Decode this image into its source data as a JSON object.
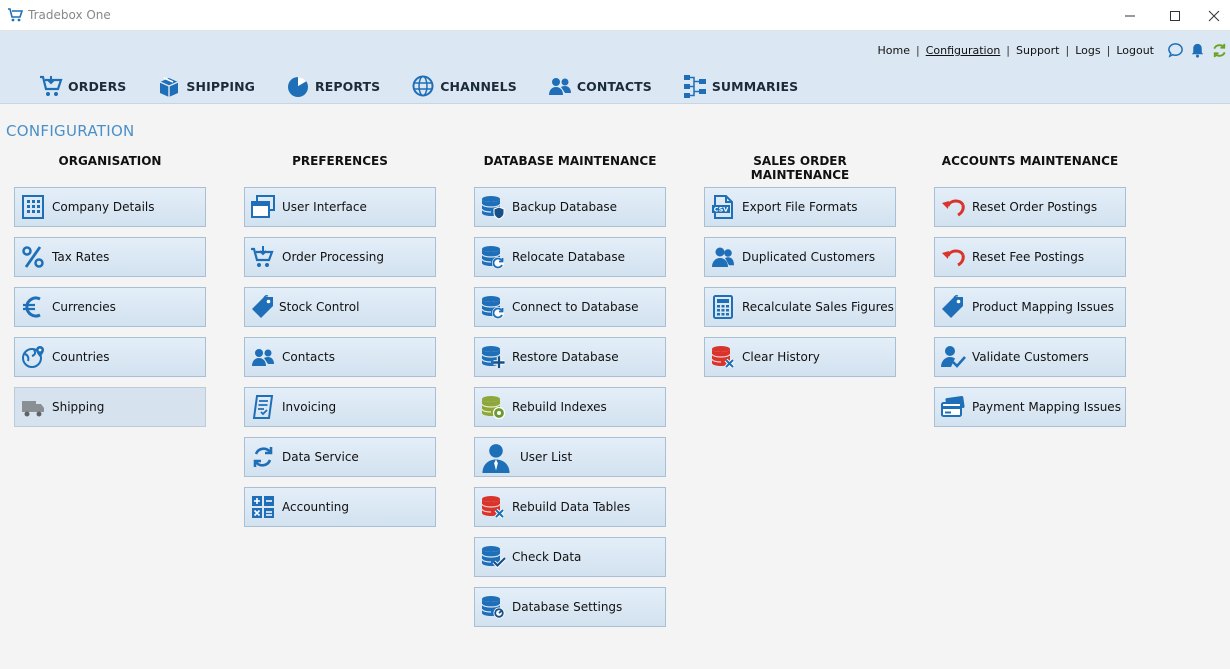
{
  "window": {
    "title": "Tradebox One"
  },
  "toplinks": [
    "Home",
    "Configuration",
    "Support",
    "Logs",
    "Logout"
  ],
  "nav": [
    "ORDERS",
    "SHIPPING",
    "REPORTS",
    "CHANNELS",
    "CONTACTS",
    "SUMMARIES"
  ],
  "page_title": "CONFIGURATION",
  "columns": {
    "organisation": {
      "title": "ORGANISATION",
      "items": [
        "Company Details",
        "Tax Rates",
        "Currencies",
        "Countries",
        "Shipping"
      ]
    },
    "preferences": {
      "title": "PREFERENCES",
      "items": [
        "User Interface",
        "Order Processing",
        "Stock Control",
        "Contacts",
        "Invoicing",
        "Data Service",
        "Accounting"
      ]
    },
    "database": {
      "title": "DATABASE MAINTENANCE",
      "items": [
        "Backup Database",
        "Relocate Database",
        "Connect to Database",
        "Restore Database",
        "Rebuild Indexes",
        "User List",
        "Rebuild Data Tables",
        "Check Data",
        "Database Settings"
      ]
    },
    "sales": {
      "title": "SALES ORDER MAINTENANCE",
      "items": [
        "Export File Formats",
        "Duplicated Customers",
        "Recalculate Sales Figures",
        "Clear History"
      ]
    },
    "accounts": {
      "title": "ACCOUNTS MAINTENANCE",
      "items": [
        "Reset Order Postings",
        "Reset Fee Postings",
        "Product Mapping Issues",
        "Validate Customers",
        "Payment Mapping Issues"
      ]
    }
  },
  "colors": {
    "accent": "#1e6fb8",
    "danger": "#d9342b",
    "ok": "#6a9a2e",
    "header_bg": "#dbe8f3"
  }
}
